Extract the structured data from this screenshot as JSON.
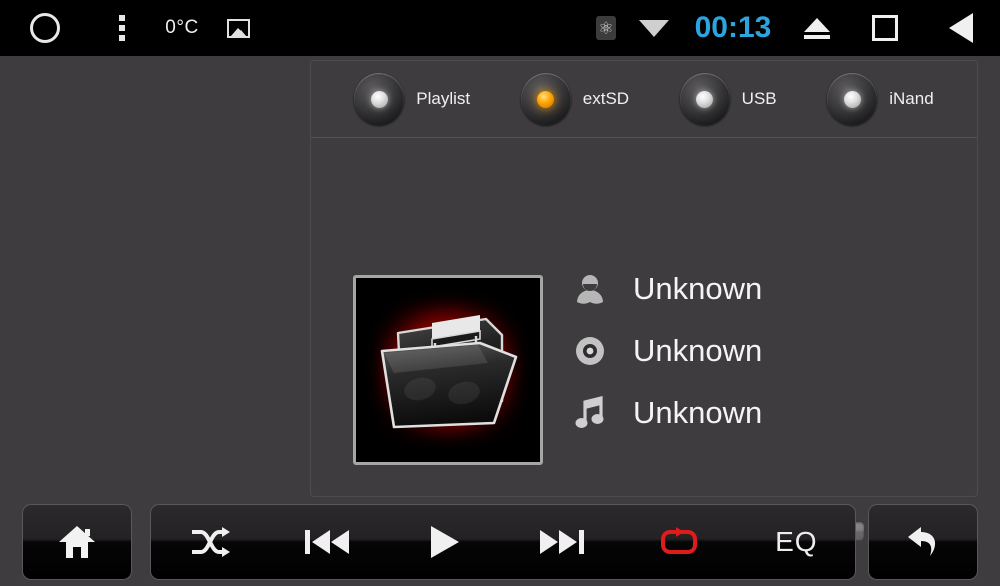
{
  "statusbar": {
    "left_items": [
      {
        "name": "circle-icon",
        "label": ""
      },
      {
        "name": "overflow-menu-icon",
        "label": ""
      },
      {
        "name": "temperature",
        "label": "0°C"
      },
      {
        "name": "image-icon",
        "label": ""
      }
    ],
    "temperature": "0°C",
    "clock": "00:13",
    "clock_color": "#2da4e0",
    "right_items": [
      {
        "name": "bluetooth-icon",
        "glyph": "ᛦ"
      },
      {
        "name": "wifi-icon",
        "glyph": ""
      },
      {
        "name": "eject-icon",
        "glyph": ""
      },
      {
        "name": "recents-icon",
        "glyph": ""
      },
      {
        "name": "back-icon",
        "glyph": ""
      }
    ]
  },
  "sources": {
    "tabs": [
      {
        "label": "Playlist",
        "selected": false
      },
      {
        "label": "extSD",
        "selected": true
      },
      {
        "label": "USB",
        "selected": false
      },
      {
        "label": "iNand",
        "selected": false
      }
    ],
    "selected_color": "#ffa800"
  },
  "now_playing": {
    "album_art": "music-folder-art",
    "artist": "Unknown",
    "album": "Unknown",
    "track": "Unknown",
    "progress_percent": 0
  },
  "controls": {
    "home": "home-icon",
    "shuffle": "shuffle-icon",
    "previous": "previous-track-icon",
    "play": "play-icon",
    "next": "next-track-icon",
    "repeat": "repeat-icon",
    "repeat_active": true,
    "repeat_color": "#e01b1b",
    "eq_label": "EQ",
    "back": "return-icon"
  }
}
